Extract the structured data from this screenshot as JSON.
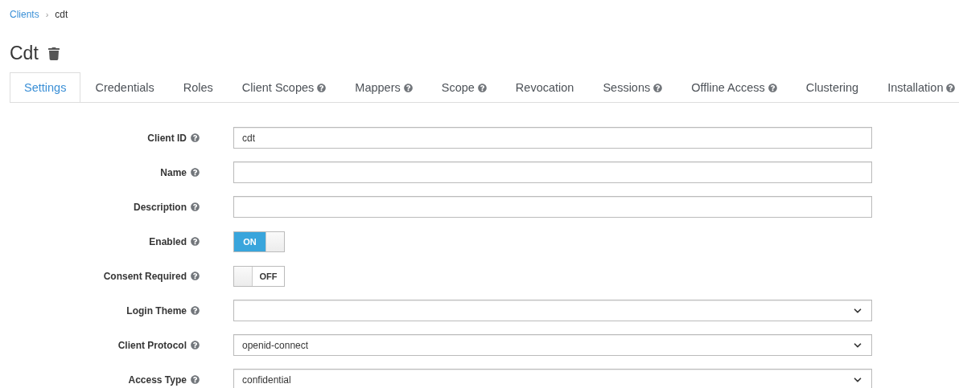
{
  "breadcrumb": [
    {
      "label": "Clients",
      "link": true
    },
    {
      "label": "cdt",
      "link": false
    }
  ],
  "breadcrumb_separator": "›",
  "title": "Cdt",
  "tabs": [
    {
      "label": "Settings",
      "selected": true,
      "help": false
    },
    {
      "label": "Credentials",
      "selected": false,
      "help": false
    },
    {
      "label": "Roles",
      "selected": false,
      "help": false
    },
    {
      "label": "Client Scopes",
      "selected": false,
      "help": true
    },
    {
      "label": "Mappers",
      "selected": false,
      "help": true
    },
    {
      "label": "Scope",
      "selected": false,
      "help": true
    },
    {
      "label": "Revocation",
      "selected": false,
      "help": false
    },
    {
      "label": "Sessions",
      "selected": false,
      "help": true
    },
    {
      "label": "Offline Access",
      "selected": false,
      "help": true
    },
    {
      "label": "Clustering",
      "selected": false,
      "help": false
    },
    {
      "label": "Installation",
      "selected": false,
      "help": true
    }
  ],
  "fields": [
    {
      "kind": "text",
      "label": "Client ID",
      "value": "cdt"
    },
    {
      "kind": "text",
      "label": "Name"
    },
    {
      "kind": "text",
      "label": "Description"
    },
    {
      "kind": "toggle",
      "label": "Enabled",
      "on": true,
      "text": "ON"
    },
    {
      "kind": "toggle",
      "label": "Consent Required",
      "on": false,
      "text": "OFF"
    },
    {
      "kind": "select",
      "label": "Login Theme"
    },
    {
      "kind": "select",
      "label": "Client Protocol",
      "value": "openid-connect"
    },
    {
      "kind": "select",
      "label": "Access Type",
      "value": "confidential"
    }
  ]
}
